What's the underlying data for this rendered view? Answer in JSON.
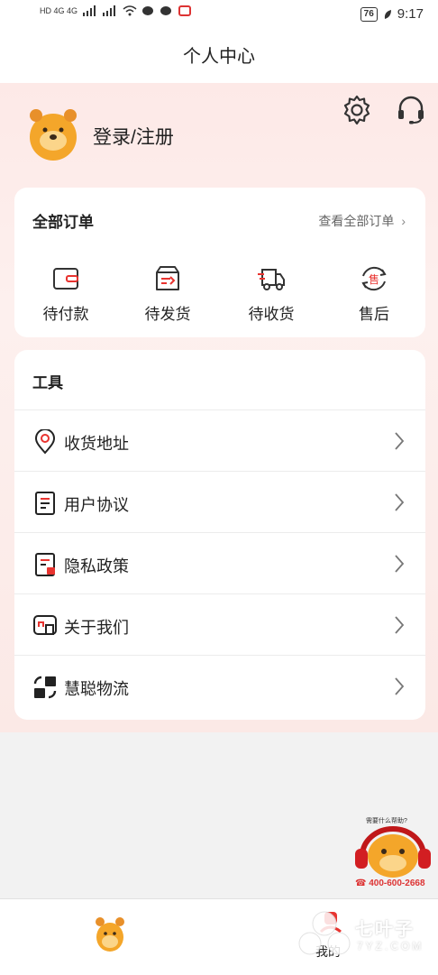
{
  "status_bar": {
    "network_left": "HD 4G 4G",
    "battery": "76",
    "time": "9:17"
  },
  "header": {
    "title": "个人中心"
  },
  "profile": {
    "login_label": "登录/注册"
  },
  "orders": {
    "title": "全部订单",
    "view_all": "查看全部订单",
    "items": [
      {
        "label": "待付款",
        "icon": "wallet-icon"
      },
      {
        "label": "待发货",
        "icon": "box-send-icon"
      },
      {
        "label": "待收货",
        "icon": "truck-icon"
      },
      {
        "label": "售后",
        "icon": "after-sale-icon"
      }
    ]
  },
  "tools": {
    "title": "工具",
    "items": [
      {
        "label": "收货地址",
        "icon": "location-pin-icon"
      },
      {
        "label": "用户协议",
        "icon": "document-icon"
      },
      {
        "label": "隐私政策",
        "icon": "privacy-document-icon"
      },
      {
        "label": "关于我们",
        "icon": "about-icon"
      },
      {
        "label": "慧聪物流",
        "icon": "logistics-icon"
      }
    ]
  },
  "help_float": {
    "caption": "需要什么帮助?",
    "phone": "400-600-2668"
  },
  "tabbar": {
    "mine_label": "我的"
  },
  "watermark": {
    "title": "七叶子",
    "sub": "7YZ.COM"
  },
  "colors": {
    "accent": "#e8332f",
    "hero_bg": "#fde9e7"
  }
}
